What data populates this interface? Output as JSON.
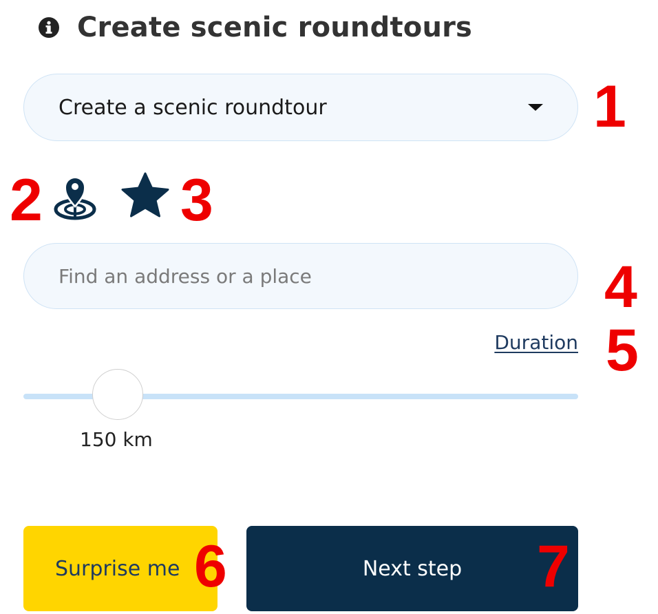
{
  "header": {
    "title": "Create scenic roundtours",
    "icon": "info-icon"
  },
  "mode_select": {
    "selected": "Create a scenic roundtour",
    "icon": "caret-down-icon"
  },
  "icons": {
    "location_target": "location-target-icon",
    "favorites": "star-icon"
  },
  "search": {
    "placeholder": "Find an address or a place",
    "value": ""
  },
  "duration_link": "Duration",
  "slider": {
    "value_label": "150 km",
    "position_fraction": 0.17
  },
  "buttons": {
    "surprise": "Surprise me",
    "next": "Next step"
  },
  "annotations": [
    "1",
    "2",
    "3",
    "4",
    "5",
    "6",
    "7"
  ],
  "colors": {
    "annotation": "#ee0000",
    "primary_dark": "#0b2e4a",
    "accent_yellow": "#ffd500",
    "field_bg": "#f3f8fd",
    "slider_track": "#c8e2f8"
  }
}
